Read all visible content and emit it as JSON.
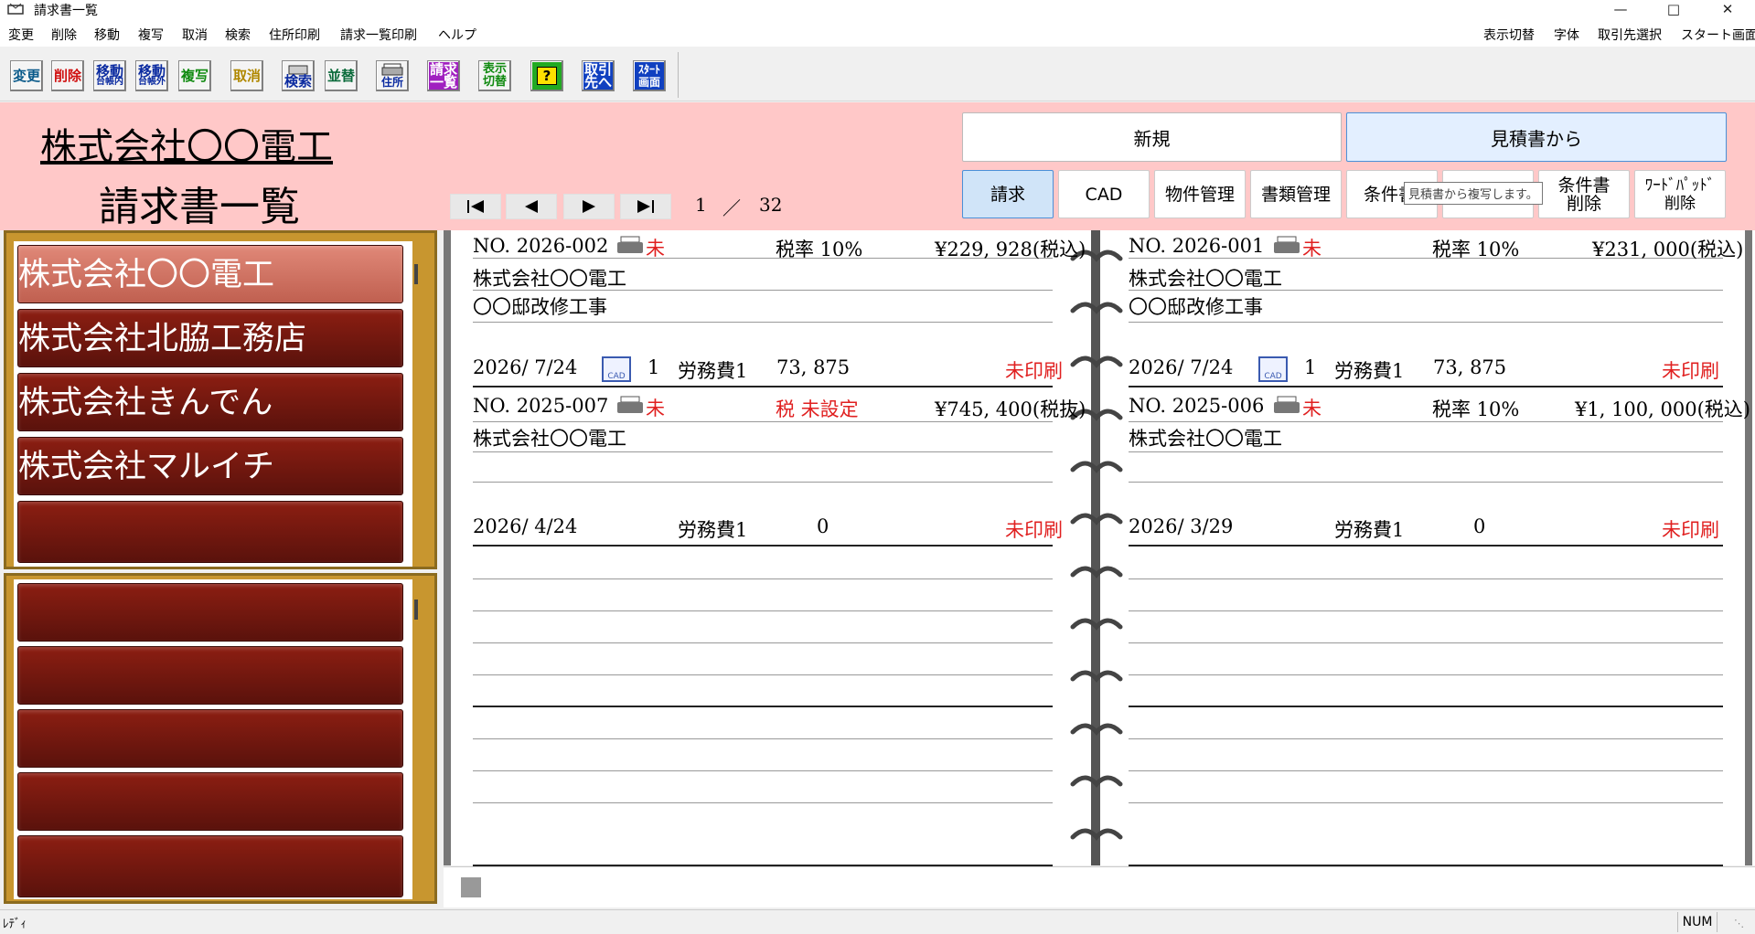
{
  "window": {
    "title": "請求書一覧"
  },
  "menu": {
    "left": [
      "変更",
      "削除",
      "移動",
      "複写",
      "取消",
      "検索",
      "住所印刷",
      "請求一覧印刷",
      "ヘルプ"
    ],
    "right": [
      "表示切替",
      "字体",
      "取引先選択",
      "スタート画面"
    ]
  },
  "toolbar": [
    {
      "l1": "変更",
      "l2": ""
    },
    {
      "l1": "削除",
      "l2": ""
    },
    {
      "l1": "移動",
      "l2": "台帳内"
    },
    {
      "l1": "移動",
      "l2": "台帳外"
    },
    {
      "l1": "複写",
      "l2": ""
    },
    {
      "l1": "取消",
      "l2": ""
    },
    {
      "l1": "",
      "l2": "検索"
    },
    {
      "l1": "並替",
      "l2": ""
    },
    {
      "l1": "",
      "l2": "住所"
    },
    {
      "l1": "請求",
      "l2": "一覧"
    },
    {
      "l1": "表示",
      "l2": "切替"
    },
    {
      "l1": "?",
      "l2": ""
    },
    {
      "l1": "取引",
      "l2": "先へ"
    },
    {
      "l1": "ｽﾀｰﾄ",
      "l2": "画面"
    }
  ],
  "header": {
    "company": "株式会社〇〇電工",
    "title": "請求書一覧",
    "page_current": "1",
    "page_sep": "／",
    "page_total": "32",
    "btn_new": "新規",
    "btn_from_estimate": "見積書から",
    "tabs": [
      "請求",
      "CAD",
      "物件管理",
      "書類管理",
      "条件書",
      "",
      "条件書\n削除",
      "ﾜｰﾄﾞﾊﾟｯﾄﾞ\n削除"
    ],
    "tooltip": "見積書から複写します。"
  },
  "clients": [
    "株式会社〇〇電工",
    "株式会社北脇工務店",
    "株式会社きんでん",
    "株式会社マルイチ",
    "",
    "",
    "",
    "",
    "",
    ""
  ],
  "invoices": [
    {
      "no": "NO. 2026-002",
      "status": "未",
      "tax": "税率 10%",
      "amount": "¥229, 928(税込)",
      "client": "株式会社〇〇電工",
      "subject": "〇〇邸改修工事",
      "date": "2026/ 7/24",
      "cad": true,
      "count": "1",
      "labor": "労務費1",
      "labor_amount": "73, 875",
      "print": "未印刷",
      "tax_red": false
    },
    {
      "no": "NO. 2026-001",
      "status": "未",
      "tax": "税率 10%",
      "amount": "¥231, 000(税込)",
      "client": "株式会社〇〇電工",
      "subject": "〇〇邸改修工事",
      "date": "2026/ 7/24",
      "cad": true,
      "count": "1",
      "labor": "労務費1",
      "labor_amount": "73, 875",
      "print": "未印刷",
      "tax_red": false
    },
    {
      "no": "NO. 2025-007",
      "status": "未",
      "tax": "税 未設定",
      "amount": "¥745, 400(税抜)",
      "client": "株式会社〇〇電工",
      "subject": "",
      "date": "2026/ 4/24",
      "cad": false,
      "count": "",
      "labor": "労務費1",
      "labor_amount": "0",
      "print": "未印刷",
      "tax_red": true
    },
    {
      "no": "NO. 2025-006",
      "status": "未",
      "tax": "税率 10%",
      "amount": "¥1, 100, 000(税込)",
      "client": "株式会社〇〇電工",
      "subject": "",
      "date": "2026/ 3/29",
      "cad": false,
      "count": "",
      "labor": "労務費1",
      "labor_amount": "0",
      "print": "未印刷",
      "tax_red": false
    }
  ],
  "cad_icon_label": "CAD",
  "status": {
    "left": "ﾚﾃﾞｨ",
    "num": "NUM"
  },
  "colors": {
    "header_bg": "#ffc8c8",
    "book": "#7a1a10",
    "book_selected": "#d87868",
    "accent_red": "#e02020"
  }
}
